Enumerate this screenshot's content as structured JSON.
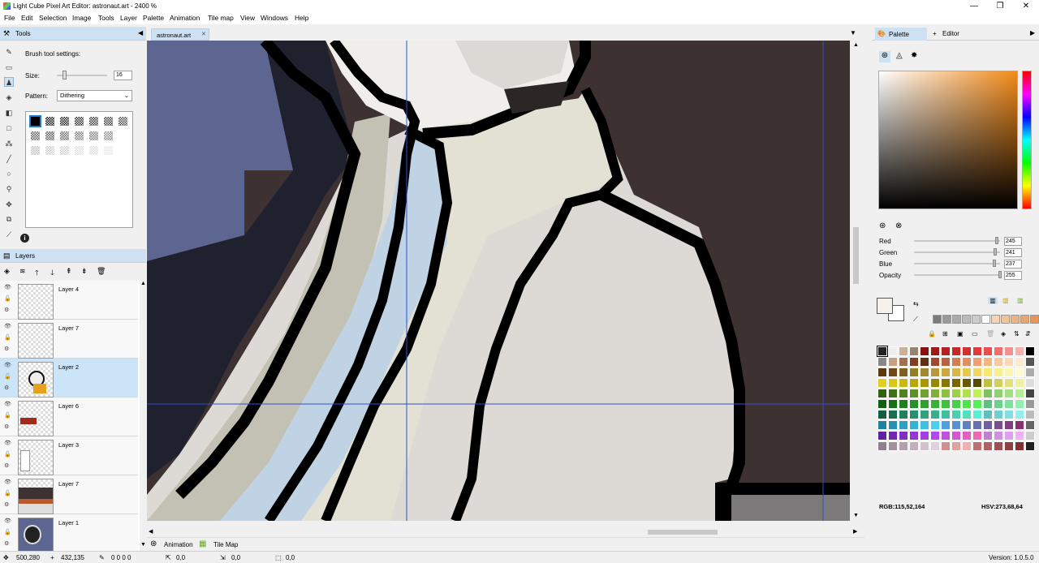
{
  "window": {
    "title": "Light Cube Pixel Art Editor: astronaut.art - 2400 %",
    "min": "—",
    "max": "❐",
    "close": "✕"
  },
  "menu": [
    "File",
    "Edit",
    "Selection",
    "Image",
    "Tools",
    "Layer",
    "Palette",
    "Animation",
    "Tile map",
    "View",
    "Windows",
    "Help"
  ],
  "tools_panel": {
    "title": "Tools",
    "settings_title": "Brush tool settings:",
    "size_label": "Size:",
    "size_value": "16",
    "size_fraction": 0.15,
    "pattern_label": "Pattern:",
    "pattern_value": "Dithering",
    "tool_icons": [
      "pencil-icon",
      "eraser-icon",
      "brush-icon",
      "fill-bucket-icon",
      "gradient-icon",
      "rectangle-icon",
      "spray-icon",
      "line-icon",
      "ellipse-icon",
      "magic-wand-icon",
      "move-icon",
      "clone-icon",
      "eyedropper-icon"
    ]
  },
  "layers_panel": {
    "title": "Layers",
    "layers": [
      {
        "name": "Layer 4"
      },
      {
        "name": "Layer 7"
      },
      {
        "name": "Layer 2",
        "selected": true
      },
      {
        "name": "Layer 6"
      },
      {
        "name": "Layer 3"
      },
      {
        "name": "Layer 7"
      },
      {
        "name": "Layer 1"
      }
    ]
  },
  "document_tab": {
    "label": "astronaut.art",
    "close": "✕"
  },
  "bottom_tabs": {
    "animation": "Animation",
    "tilemap": "Tile Map"
  },
  "right_panel": {
    "tabs": {
      "palette": "Palette",
      "editor": "Editor"
    },
    "channels": [
      {
        "label": "Red",
        "value": "245",
        "fraction": 0.96
      },
      {
        "label": "Green",
        "value": "241",
        "fraction": 0.945
      },
      {
        "label": "Blue",
        "value": "237",
        "fraction": 0.93
      },
      {
        "label": "Opacity",
        "value": "255",
        "fraction": 1.0
      }
    ],
    "primary_color": "#f5f1ed",
    "secondary_color": "#ffffff",
    "rgb_readout": "RGB:115,52,164",
    "hsv_readout": "HSV:273,68,64"
  },
  "status": {
    "cursor": "500,280",
    "size": "432,135",
    "brush": "0 0 0 0",
    "sel_pos": "0,0",
    "sel_size": "0,0",
    "misc": "0,0",
    "version": "Version: 1.0.5.0"
  },
  "colors": {
    "accent": "#cde1f2",
    "selected_row": "#cce4f7",
    "guide": "#2f4fd0"
  }
}
